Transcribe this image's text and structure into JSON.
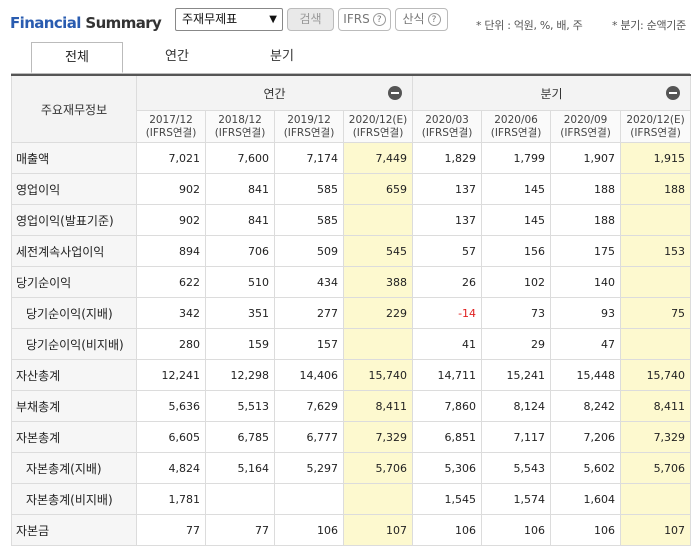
{
  "brand": {
    "part1": "Financial",
    "part2": "Summary"
  },
  "controls": {
    "statement_select": "주재무제표",
    "search_button": "검색",
    "ifrs_button": "IFRS",
    "calc_button": "산식"
  },
  "notes": {
    "unit": "* 단위 : 억원, %, 배, 주",
    "quarter": "* 분기: 순액기준"
  },
  "tabs": [
    "전체",
    "연간",
    "분기"
  ],
  "table": {
    "row_header": "주요재무정보",
    "annual_label": "연간",
    "quarter_label": "분기",
    "columns": [
      {
        "period": "2017/12",
        "basis": "(IFRS연결)"
      },
      {
        "period": "2018/12",
        "basis": "(IFRS연결)"
      },
      {
        "period": "2019/12",
        "basis": "(IFRS연결)"
      },
      {
        "period": "2020/12(E)",
        "basis": "(IFRS연결)"
      },
      {
        "period": "2020/03",
        "basis": "(IFRS연결)"
      },
      {
        "period": "2020/06",
        "basis": "(IFRS연결)"
      },
      {
        "period": "2020/09",
        "basis": "(IFRS연결)"
      },
      {
        "period": "2020/12(E)",
        "basis": "(IFRS연결)"
      }
    ],
    "rows": [
      {
        "label": "매출액",
        "values": [
          "7,021",
          "7,600",
          "7,174",
          "7,449",
          "1,829",
          "1,799",
          "1,907",
          "1,915"
        ]
      },
      {
        "label": "영업이익",
        "values": [
          "902",
          "841",
          "585",
          "659",
          "137",
          "145",
          "188",
          "188"
        ]
      },
      {
        "label": "영업이익(발표기준)",
        "values": [
          "902",
          "841",
          "585",
          "",
          "137",
          "145",
          "188",
          ""
        ]
      },
      {
        "label": "세전계속사업이익",
        "values": [
          "894",
          "706",
          "509",
          "545",
          "57",
          "156",
          "175",
          "153"
        ]
      },
      {
        "label": "당기순이익",
        "values": [
          "622",
          "510",
          "434",
          "388",
          "26",
          "102",
          "140",
          ""
        ]
      },
      {
        "label": "당기순이익(지배)",
        "values": [
          "342",
          "351",
          "277",
          "229",
          "-14",
          "73",
          "93",
          "75"
        ]
      },
      {
        "label": "당기순이익(비지배)",
        "values": [
          "280",
          "159",
          "157",
          "",
          "41",
          "29",
          "47",
          ""
        ]
      },
      {
        "label": "자산총계",
        "values": [
          "12,241",
          "12,298",
          "14,406",
          "15,740",
          "14,711",
          "15,241",
          "15,448",
          "15,740"
        ]
      },
      {
        "label": "부채총계",
        "values": [
          "5,636",
          "5,513",
          "7,629",
          "8,411",
          "7,860",
          "8,124",
          "8,242",
          "8,411"
        ]
      },
      {
        "label": "자본총계",
        "values": [
          "6,605",
          "6,785",
          "6,777",
          "7,329",
          "6,851",
          "7,117",
          "7,206",
          "7,329"
        ]
      },
      {
        "label": "자본총계(지배)",
        "values": [
          "4,824",
          "5,164",
          "5,297",
          "5,706",
          "5,306",
          "5,543",
          "5,602",
          "5,706"
        ]
      },
      {
        "label": "자본총계(비지배)",
        "values": [
          "1,781",
          "",
          "",
          "",
          "1,545",
          "1,574",
          "1,604",
          ""
        ]
      },
      {
        "label": "자본금",
        "values": [
          "77",
          "77",
          "106",
          "107",
          "106",
          "106",
          "106",
          "107"
        ]
      }
    ]
  }
}
